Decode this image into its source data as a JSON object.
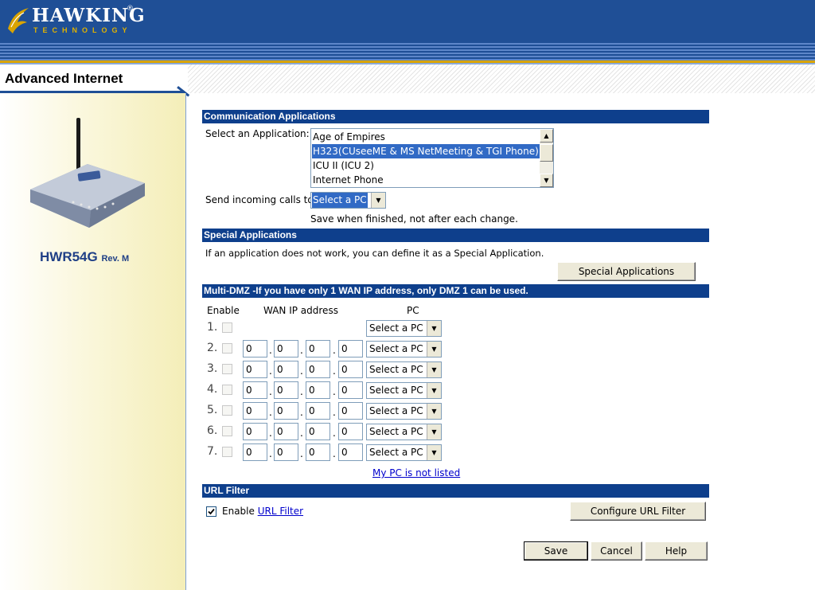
{
  "brand": {
    "name": "HAWKING",
    "sub": "TECHNOLOGY",
    "reg": "®"
  },
  "page_title": "Advanced Internet",
  "model": {
    "name": "HWR54G",
    "rev": "Rev. M"
  },
  "comm": {
    "header": "Communication Applications",
    "select_label": "Select an Application:",
    "apps": [
      "Age of Empires",
      "H323(CUseeME & MS NetMeeting & TGI Phone)",
      "ICU II (ICU 2)",
      "Internet Phone"
    ],
    "selected_index": 1,
    "send_label": "Send incoming calls to:",
    "send_value": "Select a PC",
    "save_note": "Save when finished, not after each change."
  },
  "special": {
    "header": "Special Applications",
    "desc": "If an application does not work, you can define it as a Special Application.",
    "button": "Special Applications"
  },
  "dmz": {
    "header": "Multi-DMZ -If you have only 1 WAN IP address, only DMZ 1 can be used.",
    "col_enable": "Enable",
    "col_wan": "WAN IP address",
    "col_pc": "PC",
    "rows": [
      {
        "num": "1.",
        "ip": null,
        "pc": "Select a PC"
      },
      {
        "num": "2.",
        "ip": [
          "0",
          "0",
          "0",
          "0"
        ],
        "pc": "Select a PC"
      },
      {
        "num": "3.",
        "ip": [
          "0",
          "0",
          "0",
          "0"
        ],
        "pc": "Select a PC"
      },
      {
        "num": "4.",
        "ip": [
          "0",
          "0",
          "0",
          "0"
        ],
        "pc": "Select a PC"
      },
      {
        "num": "5.",
        "ip": [
          "0",
          "0",
          "0",
          "0"
        ],
        "pc": "Select a PC"
      },
      {
        "num": "6.",
        "ip": [
          "0",
          "0",
          "0",
          "0"
        ],
        "pc": "Select a PC"
      },
      {
        "num": "7.",
        "ip": [
          "0",
          "0",
          "0",
          "0"
        ],
        "pc": "Select a PC"
      }
    ],
    "not_listed": "My PC is not listed"
  },
  "url": {
    "header": "URL Filter",
    "enable_prefix": "Enable",
    "enable_link": "URL Filter",
    "checked": true,
    "configure_button": "Configure URL Filter"
  },
  "actions": {
    "save": "Save",
    "cancel": "Cancel",
    "help": "Help"
  }
}
